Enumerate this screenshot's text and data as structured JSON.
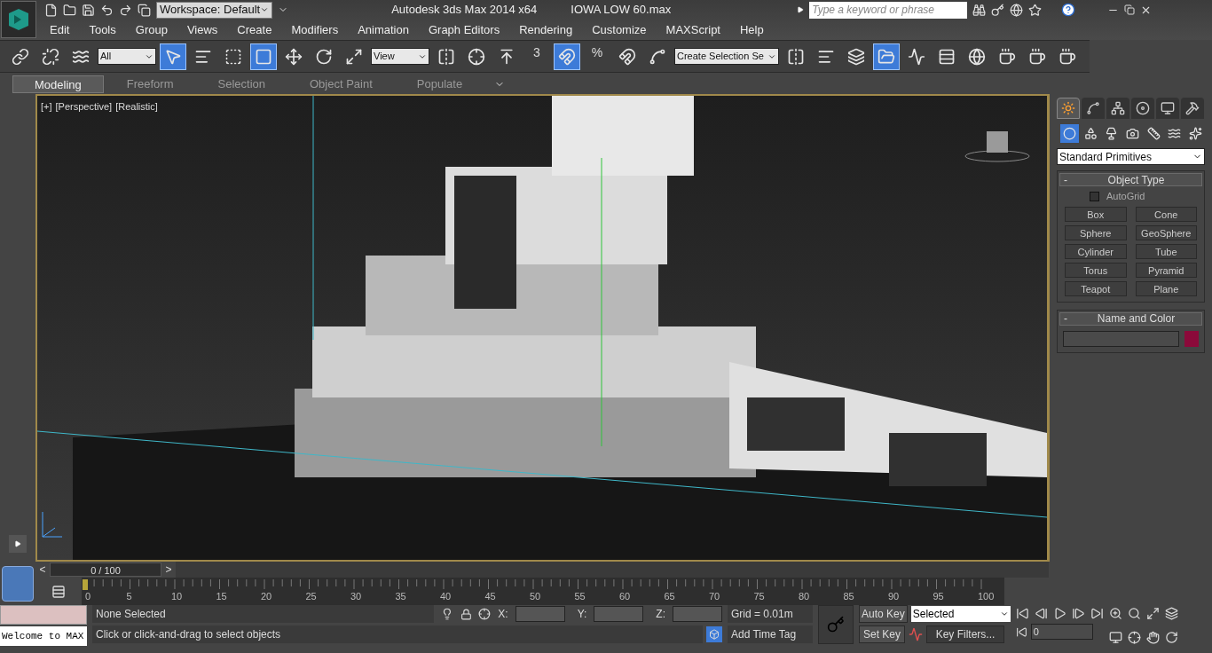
{
  "title_bar": {
    "workspace": "Workspace: Default",
    "title": "Autodesk 3ds Max  2014 x64",
    "file": "IOWA LOW 60.max",
    "search": {
      "placeholder": "Type a keyword or phrase"
    }
  },
  "menu": [
    "Edit",
    "Tools",
    "Group",
    "Views",
    "Create",
    "Modifiers",
    "Animation",
    "Graph Editors",
    "Rendering",
    "Customize",
    "MAXScript",
    "Help"
  ],
  "toolbar": [
    {
      "kind": "button",
      "active": false
    },
    {
      "kind": "button",
      "active": false
    },
    {
      "kind": "button",
      "active": false
    },
    {
      "kind": "dropdown",
      "value": "All"
    },
    {
      "kind": "button",
      "active": true
    },
    {
      "kind": "button",
      "active": false
    },
    {
      "kind": "button",
      "active": false
    },
    {
      "kind": "button",
      "active": true
    },
    {
      "kind": "button",
      "active": false
    },
    {
      "kind": "button",
      "active": false
    },
    {
      "kind": "button",
      "active": false
    },
    {
      "kind": "dropdown",
      "value": "View"
    },
    {
      "kind": "button",
      "active": false
    },
    {
      "kind": "button",
      "active": false
    },
    {
      "kind": "button",
      "active": false
    },
    {
      "kind": "snap",
      "label": "3",
      "active": false
    },
    {
      "kind": "button",
      "active": true
    },
    {
      "kind": "snap",
      "label": "%",
      "active": false
    },
    {
      "kind": "button",
      "active": false
    },
    {
      "kind": "button",
      "active": false
    },
    {
      "kind": "dropdown",
      "value": "Create Selection Se"
    },
    {
      "kind": "button",
      "active": false
    },
    {
      "kind": "button",
      "active": false
    },
    {
      "kind": "button",
      "active": false
    },
    {
      "kind": "button",
      "active": true
    },
    {
      "kind": "button",
      "active": false
    },
    {
      "kind": "button",
      "active": false
    },
    {
      "kind": "button",
      "active": false
    },
    {
      "kind": "button",
      "active": false
    },
    {
      "kind": "button",
      "active": false
    },
    {
      "kind": "button",
      "active": false
    }
  ],
  "ribbon_tabs": [
    {
      "label": "Modeling",
      "selected": true
    },
    {
      "label": "Freeform",
      "selected": false
    },
    {
      "label": "Selection",
      "selected": false
    },
    {
      "label": "Object Paint",
      "selected": false
    },
    {
      "label": "Populate",
      "selected": false
    }
  ],
  "viewport": {
    "labels": [
      "[+]",
      "[Perspective]",
      "[Realistic]"
    ]
  },
  "command_panel": {
    "tabs": [
      {
        "selected": true
      },
      {
        "selected": false
      },
      {
        "selected": false
      },
      {
        "selected": false
      },
      {
        "selected": false
      },
      {
        "selected": false
      }
    ],
    "categories": [
      {
        "selected": true
      },
      {
        "selected": false
      },
      {
        "selected": false
      },
      {
        "selected": false
      },
      {
        "selected": false
      },
      {
        "selected": false
      },
      {
        "selected": false
      }
    ],
    "dropdown": "Standard Primitives",
    "object_type": {
      "title": "Object Type",
      "collapse": "-",
      "autogrid": {
        "label": "AutoGrid",
        "checked": false
      },
      "buttons": [
        "Box",
        "Cone",
        "Sphere",
        "GeoSphere",
        "Cylinder",
        "Tube",
        "Torus",
        "Pyramid",
        "Teapot",
        "Plane"
      ]
    },
    "name_and_color": {
      "title": "Name and Color",
      "collapse": "-",
      "color": "#8b0a3a"
    }
  },
  "time_slider": {
    "prev": "<",
    "position": "0 / 100",
    "next": ">",
    "level": 0
  },
  "track_bar": {
    "labels": [
      "0",
      "5",
      "10",
      "15",
      "20",
      "25",
      "30",
      "35",
      "40",
      "45",
      "50",
      "55",
      "60",
      "65",
      "70",
      "75",
      "80",
      "85",
      "90",
      "95",
      "100"
    ]
  },
  "status": {
    "listener": "Welcome to MAX",
    "selection": "None Selected",
    "prompt": "Click or click-and-drag to select objects",
    "x_label": "X:",
    "y_label": "Y:",
    "z_label": "Z:",
    "grid": "Grid = 0.01m",
    "time_tag": "Add Time Tag",
    "auto_key": "Auto Key",
    "set_key": "Set Key",
    "key_mode": "Selected",
    "key_filters": "Key Filters...",
    "frame": "0"
  }
}
